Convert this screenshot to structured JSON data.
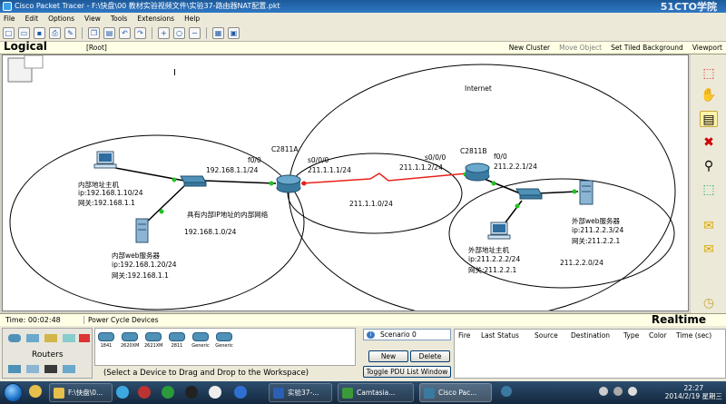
{
  "window": {
    "title": "Cisco Packet Tracer - F:\\快盘\\00 教材实验视频文件\\实验37-路由器NAT配置.pkt",
    "watermark": "51CTO学院"
  },
  "menu": [
    "File",
    "Edit",
    "Options",
    "View",
    "Tools",
    "Extensions",
    "Help"
  ],
  "toolbar": {
    "icons": [
      "new-icon",
      "open-icon",
      "save-icon",
      "print-icon",
      "wizard-icon",
      "copy-icon",
      "paste-icon",
      "undo-icon",
      "redo-icon",
      "zoom-in-icon",
      "zoom-reset-icon",
      "zoom-out-icon",
      "drawing-palette-icon",
      "custom-device-icon"
    ]
  },
  "logical_bar": {
    "label": "Logical",
    "root": "[Root]",
    "new_cluster": "New Cluster",
    "move_object": "Move Object",
    "set_bg": "Set Tiled Background",
    "viewport": "Viewport"
  },
  "topology": {
    "cloud_internet": "Internet",
    "router_a": "C2811A",
    "router_b": "C2811B",
    "a_f00": "f0/0",
    "a_f00_ip": "192.168.1.1/24",
    "a_s000": "s0/0/0",
    "a_s000_ip": "211.1.1.1/24",
    "b_s000": "s0/0/0",
    "b_s000_ip": "211.1.1.2/24",
    "b_f00": "f0/0",
    "b_f00_ip": "211.2.2.1/24",
    "net_211_1_1": "211.1.1.0/24",
    "net_211_2_2": "211.2.2.0/24",
    "net_192": "192.168.1.0/24",
    "inside_caption": "具有内部IP地址的内部网络",
    "inside_host": {
      "name": "内部地址主机",
      "ip": "ip:192.168.1.10/24",
      "gw": "网关:192.168.1.1"
    },
    "inside_web": {
      "name": "内部web服务器",
      "ip": "ip:192.168.1.20/24",
      "gw": "网关:192.168.1.1"
    },
    "outside_host": {
      "name": "外部地址主机",
      "ip": "ip:211.2.2.2/24",
      "gw": "网关:211.2.2.1"
    },
    "outside_web": {
      "name": "外部web服务器",
      "ip": "ip:211.2.2.3/24",
      "gw": "网关:211.2.2.1"
    }
  },
  "status": {
    "time": "Time: 00:02:48",
    "power_cycle": "Power Cycle Devices",
    "mode": "Realtime"
  },
  "bottom": {
    "category": "Routers",
    "devices": [
      "1841",
      "2620XM",
      "2621XM",
      "2811",
      "Generic",
      "Generic"
    ],
    "hint": "(Select a Device to Drag and Drop to the Workspace)",
    "scenario": "Scenario 0",
    "new": "New",
    "delete": "Delete",
    "toggle_pdu": "Toggle PDU List Window",
    "pdu_columns": [
      "Fire",
      "Last Status",
      "Source",
      "Destination",
      "Type",
      "Color",
      "Time (sec)"
    ]
  },
  "taskbar": {
    "tasks": [
      "F:\\快盘\\0...",
      "实验37-...",
      "Camtasia...",
      "Cisco Pac..."
    ],
    "clock_time": "22:27",
    "clock_date": "2014/2/19 星期三"
  },
  "colors": {
    "serial_link": "#e8201a",
    "ethernet_link": "#000000",
    "link_up": "#22c022"
  }
}
